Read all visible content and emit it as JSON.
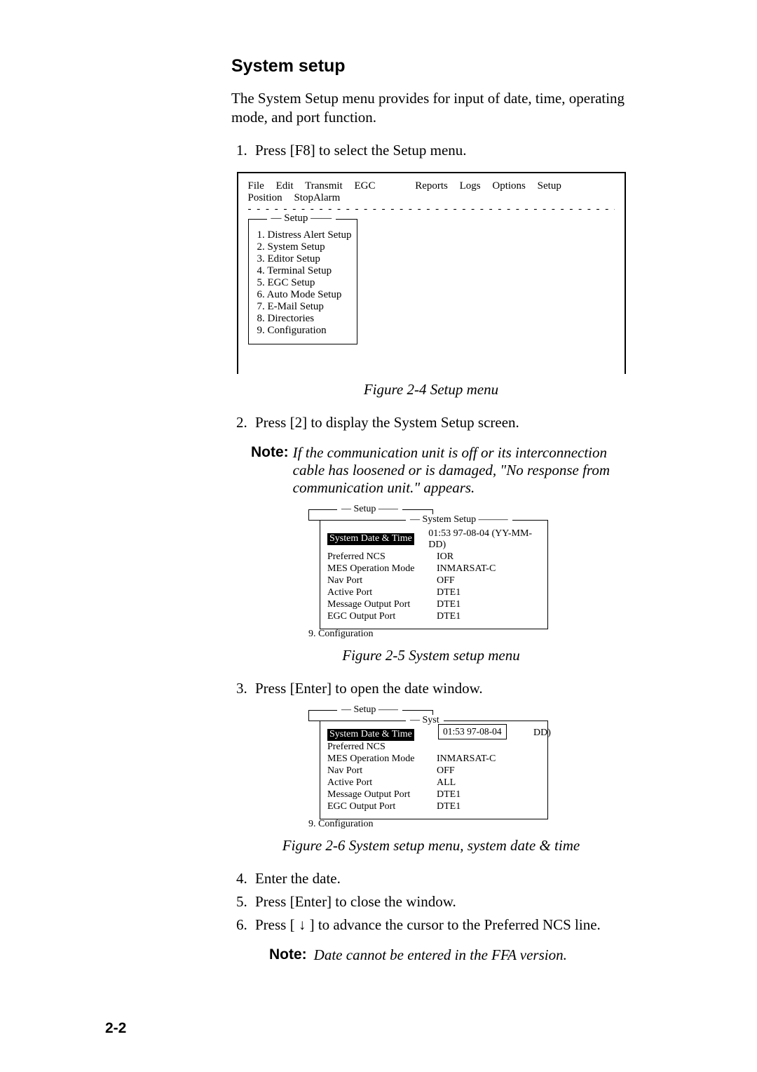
{
  "section_title": "System setup",
  "intro": "The System Setup menu provides for input of date, time, operating mode, and port function.",
  "step1": "Press [F8] to select the Setup menu.",
  "menubar": [
    "File",
    "Edit",
    "Transmit",
    "EGC",
    "Reports",
    "Logs",
    "Options",
    "Setup",
    "Position",
    "StopAlarm"
  ],
  "setup_menu_title": "Setup",
  "setup_items": [
    "1. Distress Alert Setup",
    "2. System Setup",
    "3. Editor Setup",
    "4. Terminal Setup",
    "5. EGC Setup",
    "6. Auto Mode Setup",
    "7. E-Mail Setup",
    "8. Directories",
    "9. Configuration"
  ],
  "fig24": "Figure 2-4 Setup menu",
  "step2": "Press [2] to display the System Setup screen.",
  "note1_label": "Note:",
  "note1_text": "If the communication unit is off or its interconnection cable has loosened or is damaged, \"No response from communication unit.\" appears.",
  "system_setup_title": "System Setup",
  "ss_rows": {
    "r1l": "System Date & Time",
    "r1v": "01:53  97-08-04 (YY-MM-DD)",
    "r2l": "Preferred NCS",
    "r2v": "IOR",
    "r3l": "MES Operation Mode",
    "r3v": "INMARSAT-C",
    "r4l": "Nav Port",
    "r4v": "OFF",
    "r5l": "Active Port",
    "r5v": "DTE1",
    "r6l": "Message Output Port",
    "r6v": "DTE1",
    "r7l": "EGC Output Port",
    "r7v": "DTE1"
  },
  "config_line": "9. Configuration",
  "fig25": "Figure 2-5 System setup menu",
  "step3": "Press [Enter] to open the date window.",
  "syst_partial": "Syst",
  "dd_tail": "DD)",
  "date_input": " 01:53  97-08-04 ",
  "ss2_rows": {
    "r1l": "System Date & Time",
    "r1v": "",
    "r2l": "Preferred NCS",
    "r2v": "",
    "r3l": "MES Operation Mode",
    "r3v": "INMARSAT-C",
    "r4l": "Nav Port",
    "r4v": "OFF",
    "r5l": "Active Port",
    "r5v": "ALL",
    "r6l": "Message Output Port",
    "r6v": "DTE1",
    "r7l": "EGC Output Port",
    "r7v": "DTE1"
  },
  "fig26": "Figure 2-6 System setup menu, system date & time",
  "step4": "Enter the date.",
  "step5": "Press [Enter] to close the window.",
  "step6a": "Press [ ",
  "step6_arrow": "↓",
  "step6b": " ] to advance the cursor to the Preferred NCS line.",
  "note2_label": "Note:",
  "note2_text": "Date cannot be entered in the FFA version.",
  "pagenum": "2-2"
}
